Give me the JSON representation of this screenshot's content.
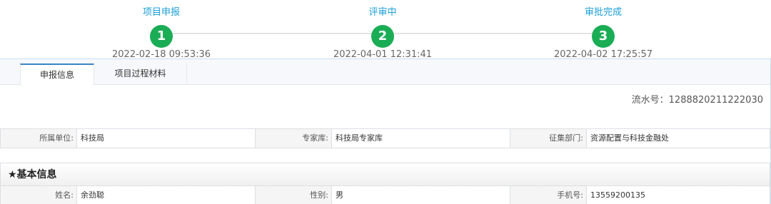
{
  "steps": [
    {
      "label": "项目申报",
      "number": "1",
      "time": "2022-02-18 09:53:36"
    },
    {
      "label": "评审中",
      "number": "2",
      "time": "2022-04-01 12:31:41"
    },
    {
      "label": "审批完成",
      "number": "3",
      "time": "2022-04-02 17:25:57"
    }
  ],
  "colors": {
    "step_done": "#1aad55",
    "step_label": "#1a9fd8",
    "active_tab": "#3b82c4"
  },
  "tabs": [
    {
      "label": "申报信息",
      "active": true
    },
    {
      "label": "项目过程材料",
      "active": false
    }
  ],
  "serial": "流水号：1288820211222030",
  "unit_row": {
    "unit_label": "所属单位:",
    "unit_value": "科技局",
    "expert_label": "专家库:",
    "expert_value": "科技局专家库",
    "dept_label": "征集部门:",
    "dept_value": "资源配置与科技金融处"
  },
  "basic_info": {
    "title": "★基本信息",
    "name_label": "姓名:",
    "name_value": "余劲聪",
    "gender_label": "性别:",
    "gender_value": "男",
    "phone_label": "手机号:",
    "phone_value": "13559200135"
  }
}
